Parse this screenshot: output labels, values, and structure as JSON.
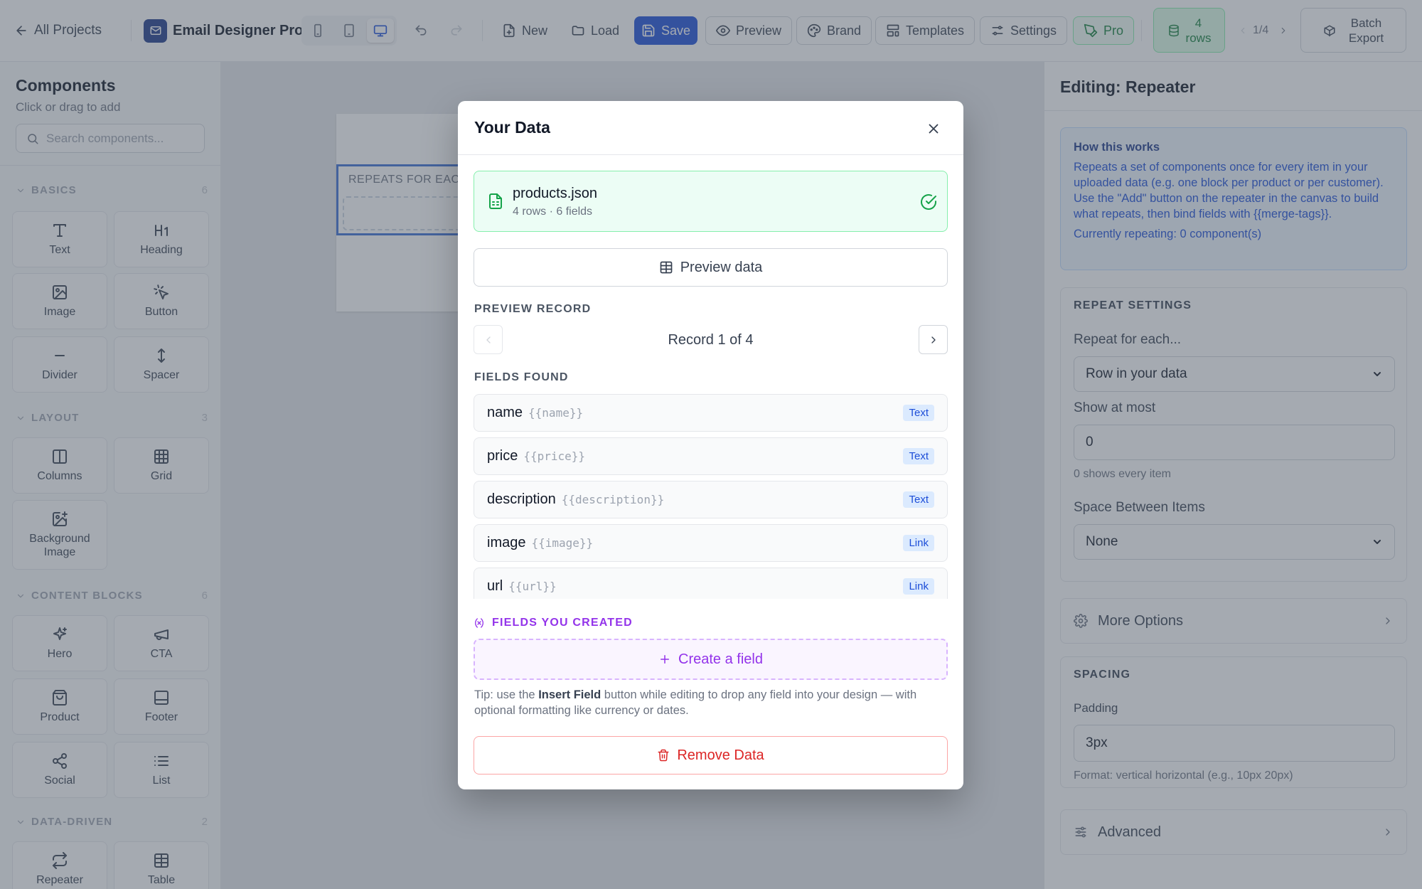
{
  "topbar": {
    "back_label": "All Projects",
    "app_title": "Email Designer Pro",
    "new_label": "New",
    "load_label": "Load",
    "save_label": "Save",
    "preview_label": "Preview",
    "brand_label": "Brand",
    "templates_label": "Templates",
    "settings_label": "Settings",
    "pro_label": "Pro",
    "rows_count": "4",
    "rows_label": "rows",
    "record_pager": "1/4",
    "batch_line1": "Batch",
    "batch_line2": "Export",
    "accent_color": "#1d4ed8"
  },
  "sidebar": {
    "title": "Components",
    "subtitle": "Click or drag to add",
    "search_placeholder": "Search components...",
    "sections": [
      {
        "label": "BASICS",
        "count": "6",
        "items": [
          {
            "label": "Text",
            "icon": "text-icon"
          },
          {
            "label": "Heading",
            "icon": "heading-icon"
          },
          {
            "label": "Image",
            "icon": "image-icon"
          },
          {
            "label": "Button",
            "icon": "pointer-icon"
          },
          {
            "label": "Divider",
            "icon": "minus-icon"
          },
          {
            "label": "Spacer",
            "icon": "arrows-vertical-icon"
          }
        ]
      },
      {
        "label": "LAYOUT",
        "count": "3",
        "items": [
          {
            "label": "Columns",
            "icon": "columns-icon"
          },
          {
            "label": "Grid",
            "icon": "grid-icon"
          },
          {
            "label": "Background Image",
            "icon": "image-plus-icon"
          }
        ]
      },
      {
        "label": "CONTENT BLOCKS",
        "count": "6",
        "items": [
          {
            "label": "Hero",
            "icon": "sparkles-icon"
          },
          {
            "label": "CTA",
            "icon": "megaphone-icon"
          },
          {
            "label": "Product",
            "icon": "shopping-bag-icon"
          },
          {
            "label": "Footer",
            "icon": "footer-icon"
          },
          {
            "label": "Social",
            "icon": "share-icon"
          },
          {
            "label": "List",
            "icon": "list-icon"
          }
        ]
      },
      {
        "label": "DATA-DRIVEN",
        "count": "2",
        "items": [
          {
            "label": "Repeater",
            "icon": "repeat-icon"
          },
          {
            "label": "Table",
            "icon": "table-icon"
          }
        ]
      }
    ]
  },
  "canvas": {
    "repeater_label": "REPEATS FOR EACH"
  },
  "modal": {
    "title": "Your Data",
    "file_name": "products.json",
    "file_meta": "4 rows · 6 fields",
    "preview_btn": "Preview data",
    "preview_record_heading": "PREVIEW RECORD",
    "record_text": "Record 1 of 4",
    "fields_heading": "FIELDS FOUND",
    "fields": [
      {
        "name": "name",
        "tag": "{{name}}",
        "type": "Text"
      },
      {
        "name": "price",
        "tag": "{{price}}",
        "type": "Text"
      },
      {
        "name": "description",
        "tag": "{{description}}",
        "type": "Text"
      },
      {
        "name": "image",
        "tag": "{{image}}",
        "type": "Link"
      },
      {
        "name": "url",
        "tag": "{{url}}",
        "type": "Link"
      }
    ],
    "created_heading": "FIELDS YOU CREATED",
    "create_btn": "Create a field",
    "tip_prefix": "Tip: use the ",
    "tip_bold": "Insert Field",
    "tip_suffix": " button while editing to drop any field into your design — with optional formatting like currency or dates.",
    "remove_btn": "Remove Data"
  },
  "right_panel": {
    "title": "Editing: Repeater",
    "info_heading": "How this works",
    "info_body": "Repeats a set of components once for every item in your uploaded data (e.g. one block per product or per customer). Use the \"Add\" button on the repeater in the canvas to build what repeats, then bind fields with {{merge-tags}}.",
    "info_status": "Currently repeating: 0 component(s)",
    "repeat_heading": "REPEAT SETTINGS",
    "repeat_for_label": "Repeat for each...",
    "repeat_for_value": "Row in your data",
    "show_at_most_label": "Show at most",
    "show_at_most_value": "0",
    "show_at_most_help": "0 shows every item",
    "space_label": "Space Between Items",
    "space_value": "None",
    "more_options": "More Options",
    "spacing_heading": "SPACING",
    "padding_label": "Padding",
    "padding_value": "3px",
    "padding_help": "Format: vertical horizontal (e.g., 10px 20px)",
    "advanced": "Advanced"
  }
}
